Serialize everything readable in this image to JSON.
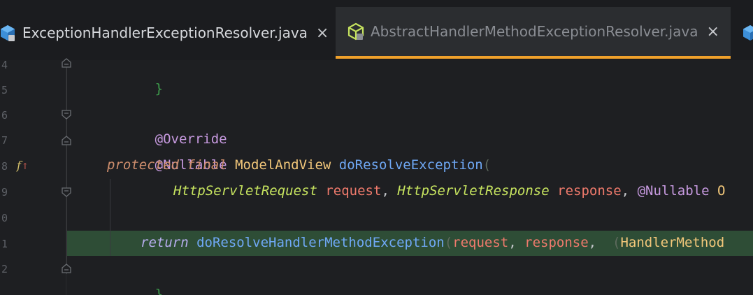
{
  "tabs": [
    {
      "label": "ExceptionHandlerExceptionResolver.java",
      "close": "×",
      "icon": "java-class-icon",
      "active": false
    },
    {
      "label": "AbstractHandlerMethodExceptionResolver.java",
      "close": "×",
      "icon": "java-abstract-class-icon",
      "active": true
    },
    {
      "label": "",
      "icon": "java-class-icon",
      "active": false
    }
  ],
  "gutter": {
    "line_numbers": [
      "4",
      "5",
      "6",
      "7",
      "8",
      "9",
      "0",
      "1",
      "2"
    ],
    "override_marker": "f"
  },
  "code": {
    "line1": {
      "brace": "}"
    },
    "line3": {
      "annotation": "@Override"
    },
    "line4": {
      "annotation": "@Nullable"
    },
    "line5": {
      "kw1": "protected",
      "kw2": "final",
      "type": "ModelAndView",
      "method": "doResolveException",
      "paren": "("
    },
    "line6": {
      "t1": "HttpServletRequest",
      "p1": "request",
      "c1": ",",
      "t2": "HttpServletResponse",
      "p2": "response",
      "c2": ",",
      "ann": "@Nullable",
      "t3": "O"
    },
    "line8": {
      "kw": "return",
      "method": "doResolveHandlerMethodException",
      "paren": "(",
      "p1": "request",
      "c1": ",",
      "p2": "response",
      "c2": ",",
      "paren2": "(",
      "type": "HandlerMethod"
    },
    "line9": {
      "brace": "}"
    }
  },
  "colors": {
    "tab_active_underline": "#f0a12b",
    "line_highlight": "#2e4d36",
    "background": "#1e1f22"
  }
}
